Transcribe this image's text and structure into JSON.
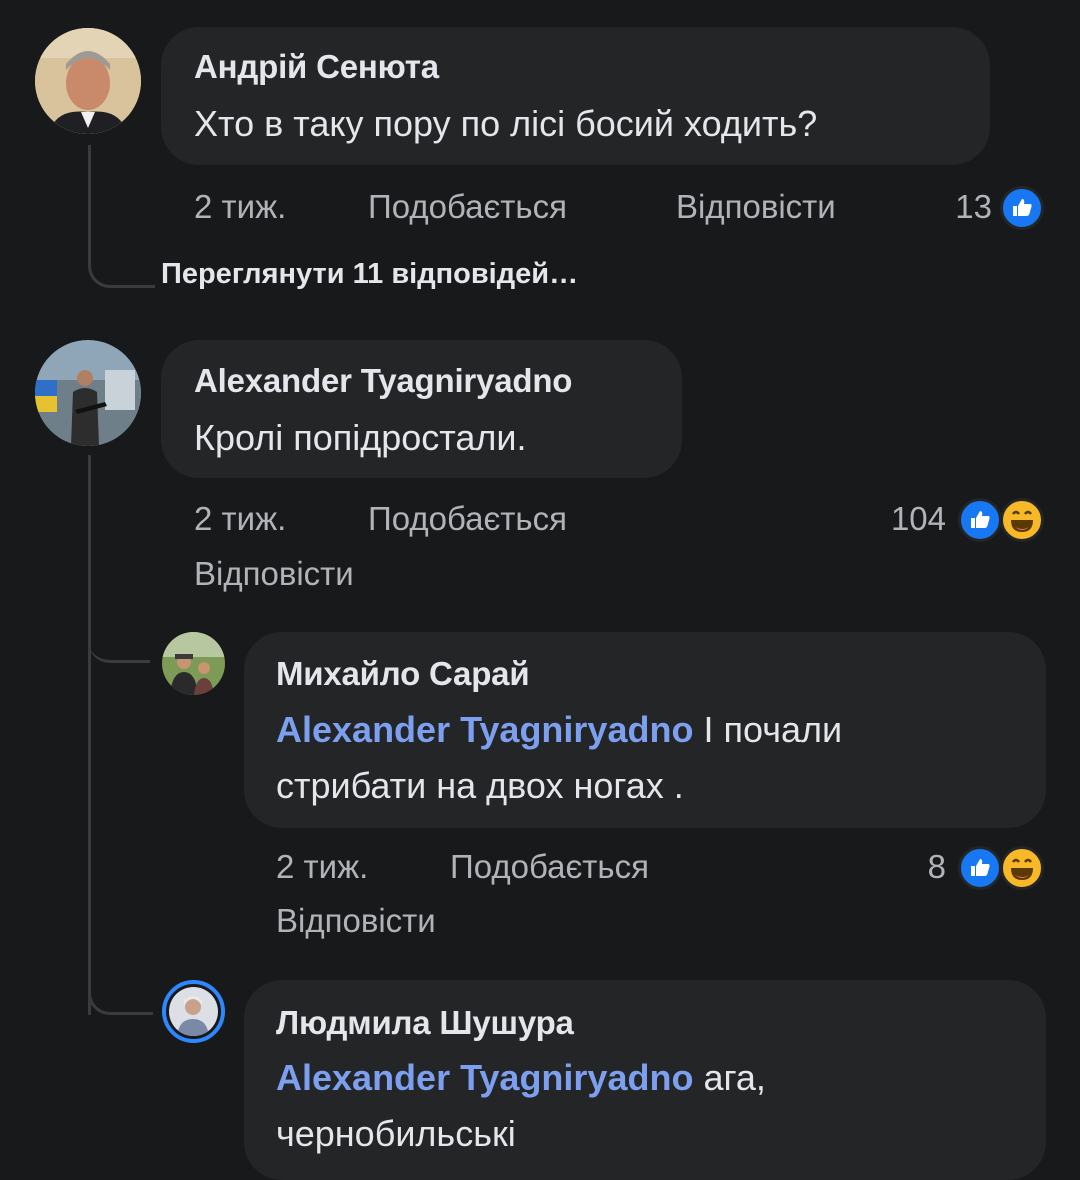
{
  "comments": [
    {
      "author": "Андрій Сенюта",
      "text": "Хто в таку пору по лісі босий ходить?",
      "time": "2 тиж.",
      "like_label": "Подобається",
      "reply_label": "Відповісти",
      "reaction_count": "13",
      "reactions": [
        "like-icon"
      ],
      "view_replies": "Переглянути 11 відповідей…"
    },
    {
      "author": "Alexander  Tyagniryadno",
      "text": "Кролі попідростали.",
      "time": "2 тиж.",
      "like_label": "Подобається",
      "reply_label": "Відповісти",
      "reaction_count": "104",
      "reactions": [
        "like-icon",
        "haha-icon"
      ],
      "replies": [
        {
          "author": "Михайло Сарай",
          "mention": "Alexander  Tyagniryadno",
          "text_line1": "І почали",
          "text_line2": "стрибати на двох ногах .",
          "time": "2 тиж.",
          "like_label": "Подобається",
          "reply_label": "Відповісти",
          "reaction_count": "8",
          "reactions": [
            "like-icon",
            "haha-icon"
          ]
        },
        {
          "author": "Людмила Шушура",
          "mention": "Alexander  Tyagniryadno",
          "text_line1": "ага,",
          "text_line2": "чернобильські"
        }
      ]
    }
  ],
  "colors": {
    "background": "#18191a",
    "bubble": "#242526",
    "mention": "#7c9ff0",
    "like": "#1877f2",
    "haha": "#f7b928"
  }
}
